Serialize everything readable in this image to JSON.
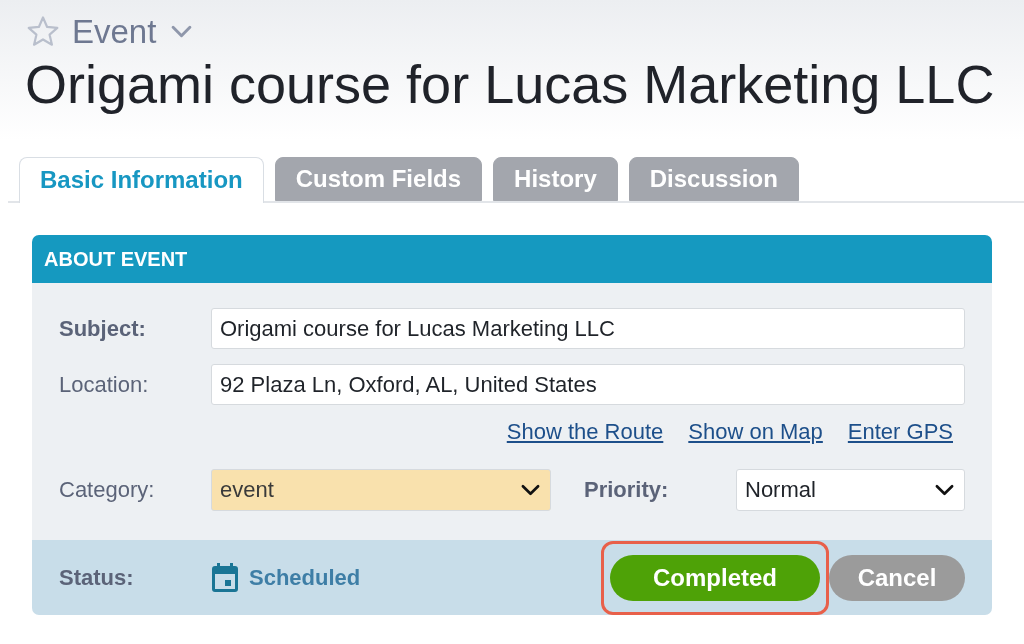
{
  "header": {
    "favorite": false,
    "record_type": "Event",
    "title": "Origami course for Lucas Marketing LLC"
  },
  "tabs": [
    {
      "label": "Basic Information",
      "selected": true
    },
    {
      "label": "Custom Fields",
      "selected": false
    },
    {
      "label": "History",
      "selected": false
    },
    {
      "label": "Discussion",
      "selected": false
    }
  ],
  "panel": {
    "title": "ABOUT EVENT",
    "fields": [
      {
        "label": "Subject:",
        "required": true,
        "value": "Origami course for Lucas Marketing LLC"
      },
      {
        "label": "Location:",
        "required": false,
        "value": "92 Plaza Ln, Oxford, AL, United States"
      }
    ],
    "links": [
      "Show the Route",
      "Show on Map",
      "Enter GPS"
    ],
    "selects": [
      {
        "label": "Category:",
        "required": false,
        "value": "event",
        "tinted": true
      },
      {
        "label": "Priority:",
        "required": true,
        "value": "Normal",
        "tinted": false
      }
    ],
    "status": {
      "label": "Status:",
      "value": "Scheduled"
    },
    "actions": [
      {
        "label": "Completed",
        "kind": "primary",
        "outlined": true
      },
      {
        "label": "Cancel",
        "kind": "secondary",
        "outlined": false
      }
    ]
  }
}
